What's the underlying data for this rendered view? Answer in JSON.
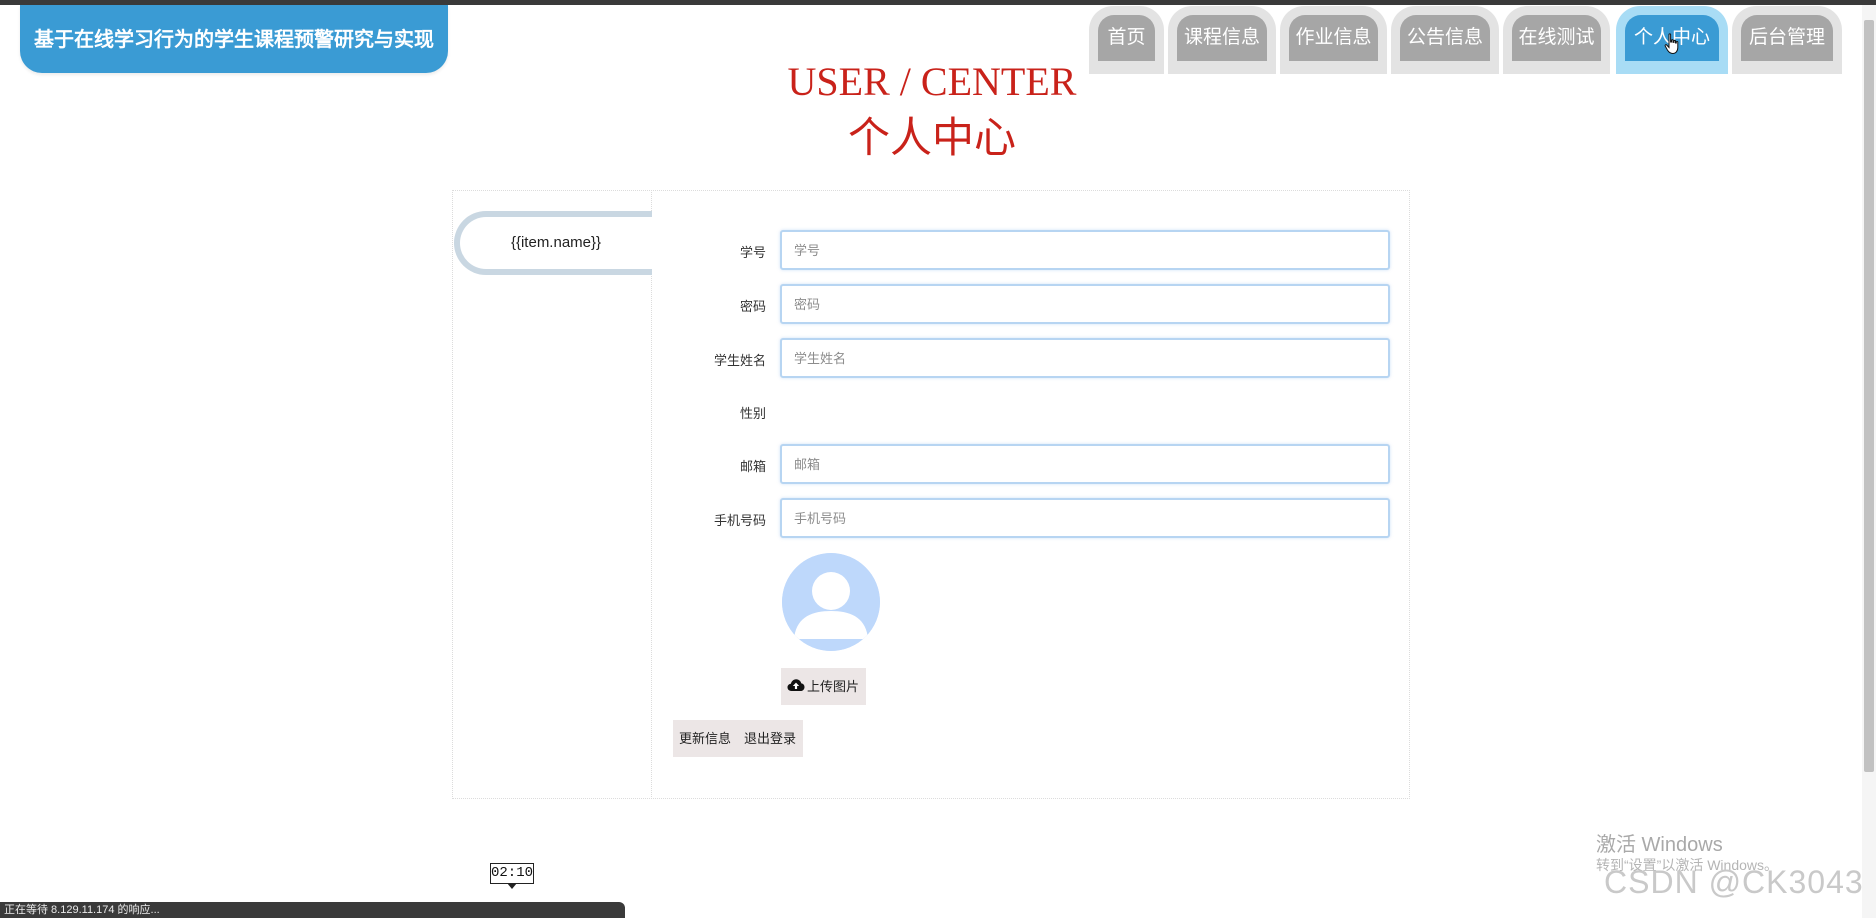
{
  "header": {
    "site_title": "基于在线学习行为的学生课程预警研究与实现"
  },
  "nav": {
    "tabs": [
      {
        "label": "首页",
        "active": false
      },
      {
        "label": "课程信息",
        "active": false
      },
      {
        "label": "作业信息",
        "active": false
      },
      {
        "label": "公告信息",
        "active": false
      },
      {
        "label": "在线测试",
        "active": false
      },
      {
        "label": "个人中心",
        "active": true
      },
      {
        "label": "后台管理",
        "active": false
      }
    ]
  },
  "hero": {
    "title_en": "USER / CENTER",
    "title_zh": "个人中心"
  },
  "sidebar": {
    "items": [
      {
        "label": "{{item.name}}"
      }
    ]
  },
  "form": {
    "student_id": {
      "label": "学号",
      "placeholder": "学号",
      "value": ""
    },
    "password": {
      "label": "密码",
      "placeholder": "密码",
      "value": ""
    },
    "student_name": {
      "label": "学生姓名",
      "placeholder": "学生姓名",
      "value": ""
    },
    "gender": {
      "label": "性别"
    },
    "email": {
      "label": "邮箱",
      "placeholder": "邮箱",
      "value": ""
    },
    "phone": {
      "label": "手机号码",
      "placeholder": "手机号码",
      "value": ""
    },
    "upload_label": "上传图片",
    "update_label": "更新信息",
    "logout_label": "退出登录"
  },
  "timer": "02:10",
  "status_bar": "正在等待 8.129.11.174 的响应...",
  "watermarks": {
    "windows_line1": "激活 Windows",
    "windows_line2": "转到“设置”以激活 Windows。",
    "csdn": "CSDN @CK3043"
  },
  "colors": {
    "brand_blue": "#3a9bd4",
    "nav_gray": "#a6a6a6",
    "hero_red": "#c9221a"
  }
}
